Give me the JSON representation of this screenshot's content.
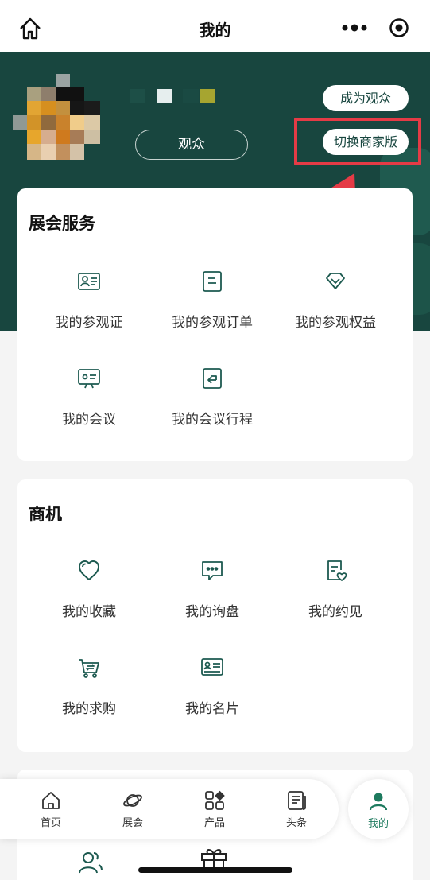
{
  "header": {
    "title": "我的"
  },
  "profile": {
    "role_label": "观众",
    "become_audience": "成为观众",
    "switch_merchant": "切换商家版"
  },
  "sections": [
    {
      "title": "展会服务",
      "items": [
        {
          "label": "我的参观证",
          "icon": "id-card-icon"
        },
        {
          "label": "我的参观订单",
          "icon": "order-icon"
        },
        {
          "label": "我的参观权益",
          "icon": "diamond-icon"
        },
        {
          "label": "我的会议",
          "icon": "meeting-icon"
        },
        {
          "label": "我的会议行程",
          "icon": "itinerary-icon"
        }
      ]
    },
    {
      "title": "商机",
      "items": [
        {
          "label": "我的收藏",
          "icon": "heart-icon"
        },
        {
          "label": "我的询盘",
          "icon": "chat-icon"
        },
        {
          "label": "我的约见",
          "icon": "appointment-icon"
        },
        {
          "label": "我的求购",
          "icon": "cart-icon"
        },
        {
          "label": "我的名片",
          "icon": "business-card-icon"
        }
      ]
    }
  ],
  "tabbar": {
    "items": [
      {
        "label": "首页",
        "icon": "home-icon"
      },
      {
        "label": "展会",
        "icon": "planet-icon"
      },
      {
        "label": "产品",
        "icon": "products-icon"
      },
      {
        "label": "头条",
        "icon": "news-icon"
      },
      {
        "label": "我的",
        "icon": "person-icon",
        "active": true
      }
    ]
  },
  "colors": {
    "primary": "#18463f",
    "accent_red": "#e53b46",
    "icon_green": "#1d5a50"
  }
}
